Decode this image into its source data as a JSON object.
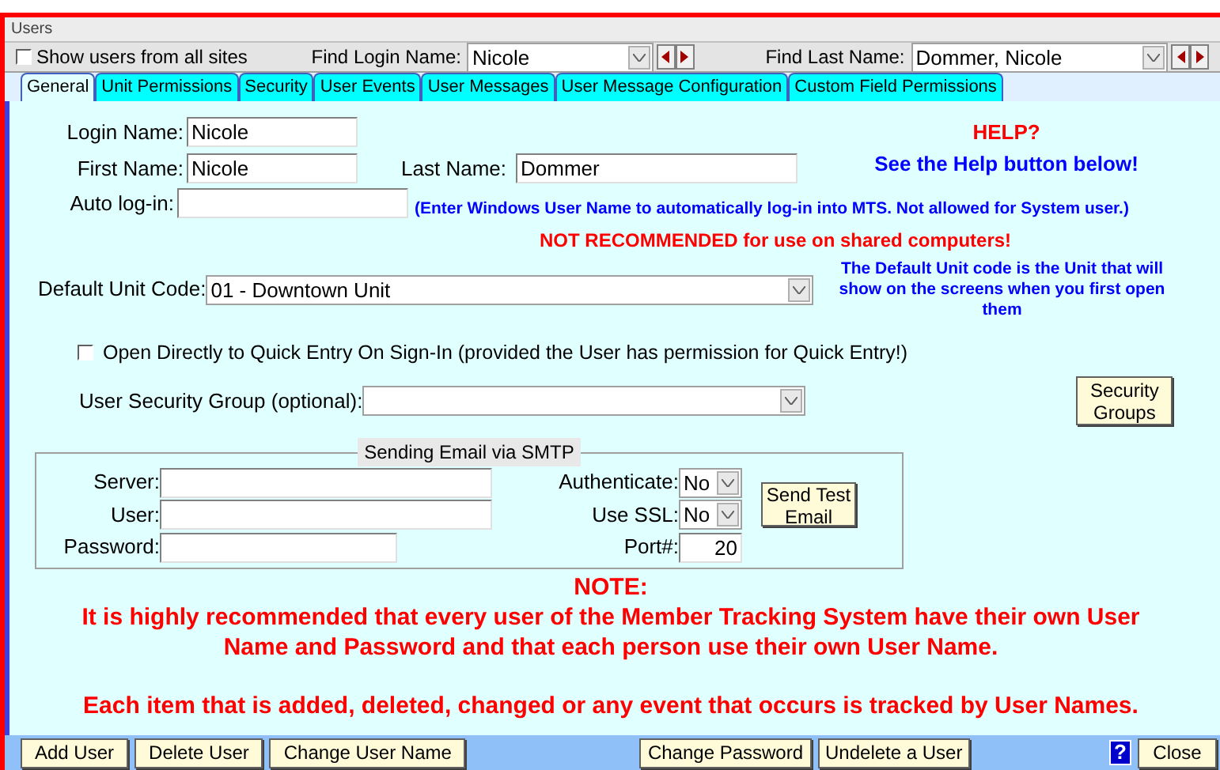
{
  "window": {
    "title": "Users"
  },
  "toolbar": {
    "show_all": {
      "label": "Show users from all sites",
      "checked": false
    },
    "find_login": {
      "label": "Find Login Name:",
      "value": "Nicole"
    },
    "find_last": {
      "label": "Find Last Name:",
      "value": "Dommer, Nicole"
    }
  },
  "tabs": [
    {
      "label": "General",
      "selected": true
    },
    {
      "label": "Unit Permissions",
      "selected": false
    },
    {
      "label": "Security",
      "selected": false
    },
    {
      "label": "User Events",
      "selected": false
    },
    {
      "label": "User Messages",
      "selected": false
    },
    {
      "label": "User Message Configuration",
      "selected": false
    },
    {
      "label": "Custom Field Permissions",
      "selected": false
    }
  ],
  "help": {
    "title": "HELP?",
    "subtitle": "See the Help button below!"
  },
  "login_name": {
    "label": "Login Name:",
    "value": "Nicole"
  },
  "first_name": {
    "label": "First Name:",
    "value": "Nicole"
  },
  "last_name": {
    "label": "Last Name:",
    "value": "Dommer"
  },
  "auto_login": {
    "label": "Auto log-in:",
    "hint": "(Enter Windows User Name to automatically log-in into MTS.  Not allowed for System user.)",
    "warning": "NOT RECOMMENDED for use on shared computers!"
  },
  "default_unit": {
    "label": "Default Unit Code:",
    "value": "01 - Downtown Unit",
    "hint": "The Default Unit code is the Unit that will show on the screens when you first open them"
  },
  "quick_entry": {
    "label": "Open Directly to Quick Entry On Sign-In (provided the User has permission for Quick Entry!)",
    "checked": false
  },
  "security_group": {
    "label": "User Security Group (optional):",
    "button": "Security Groups"
  },
  "smtp": {
    "title": "Sending Email via SMTP",
    "server": "Server:",
    "user": "User:",
    "password": "Password:",
    "authenticate": {
      "label": "Authenticate:",
      "value": "No"
    },
    "use_ssl": {
      "label": "Use SSL:",
      "value": "No"
    },
    "port": {
      "label": "Port#:",
      "value": "20"
    },
    "test_button": "Send Test Email"
  },
  "note": {
    "title": "NOTE:",
    "lines": [
      "It is highly recommended that every user of the Member Tracking System have their own User Name and Password and that each person use their own User Name.",
      "Each item that is added, deleted, changed or any event that occurs is tracked by User Names."
    ]
  },
  "buttons": {
    "left": [
      "Add User",
      "Delete User",
      "Change User Name"
    ],
    "middle": [
      "Change Password",
      "Undelete a User"
    ],
    "help": "?",
    "close": "Close"
  }
}
